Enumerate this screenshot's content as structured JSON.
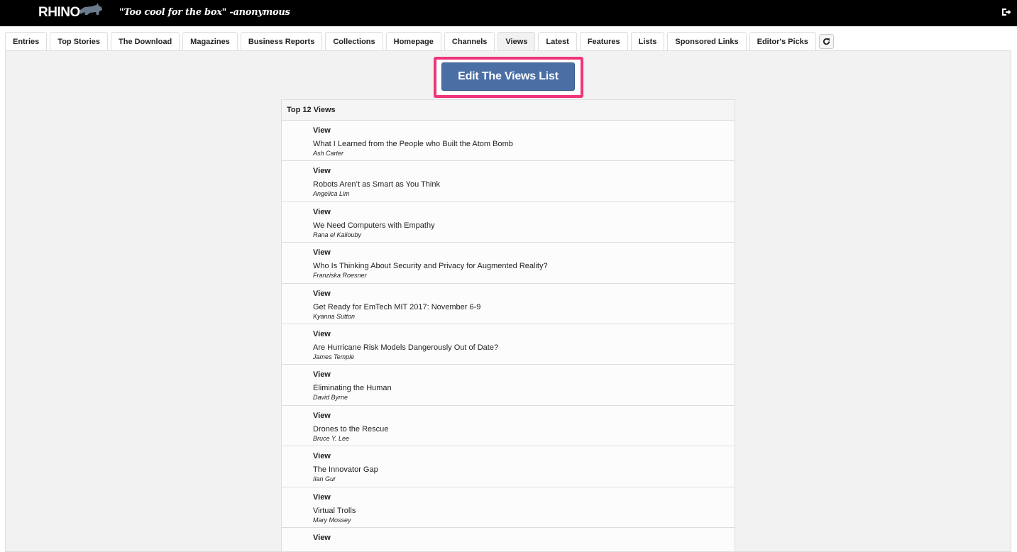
{
  "header": {
    "logo_text": "RHINO",
    "tagline": "\"Too cool for the box\" -anonymous",
    "logout_icon": "sign-out-icon"
  },
  "tabs": [
    {
      "label": "Entries",
      "active": false
    },
    {
      "label": "Top Stories",
      "active": false
    },
    {
      "label": "The Download",
      "active": false
    },
    {
      "label": "Magazines",
      "active": false
    },
    {
      "label": "Business Reports",
      "active": false
    },
    {
      "label": "Collections",
      "active": false
    },
    {
      "label": "Homepage",
      "active": false
    },
    {
      "label": "Channels",
      "active": false
    },
    {
      "label": "Views",
      "active": true
    },
    {
      "label": "Latest",
      "active": false
    },
    {
      "label": "Features",
      "active": false
    },
    {
      "label": "Lists",
      "active": false
    },
    {
      "label": "Sponsored Links",
      "active": false
    },
    {
      "label": "Editor's Picks",
      "active": false
    }
  ],
  "refresh_icon": "refresh-icon",
  "edit_button_label": "Edit The Views List",
  "highlight_color": "#f0347a",
  "accent_color": "#4a6fa5",
  "list": {
    "title": "Top 12 Views",
    "items": [
      {
        "type": "View",
        "title": "What I Learned from the People who Built the Atom Bomb",
        "author": "Ash Carter"
      },
      {
        "type": "View",
        "title": "Robots Aren’t as Smart as You Think",
        "author": "Angelica Lim"
      },
      {
        "type": "View",
        "title": "We Need Computers with Empathy",
        "author": "Rana el Kaliouby"
      },
      {
        "type": "View",
        "title": "Who Is Thinking About Security and Privacy for Augmented Reality?",
        "author": "Franziska Roesner"
      },
      {
        "type": "View",
        "title": "Get Ready for EmTech MIT 2017: November 6-9",
        "author": "Kyanna Sutton"
      },
      {
        "type": "View",
        "title": "Are Hurricane Risk Models Dangerously Out of Date?",
        "author": "James Temple"
      },
      {
        "type": "View",
        "title": "Eliminating the Human",
        "author": "David Byrne"
      },
      {
        "type": "View",
        "title": "Drones to the Rescue",
        "author": "Bruce Y. Lee"
      },
      {
        "type": "View",
        "title": "The Innovator Gap",
        "author": "Ilan Gur"
      },
      {
        "type": "View",
        "title": "Virtual Trolls",
        "author": "Mary Mossey"
      },
      {
        "type": "View",
        "title": "",
        "author": ""
      }
    ]
  }
}
